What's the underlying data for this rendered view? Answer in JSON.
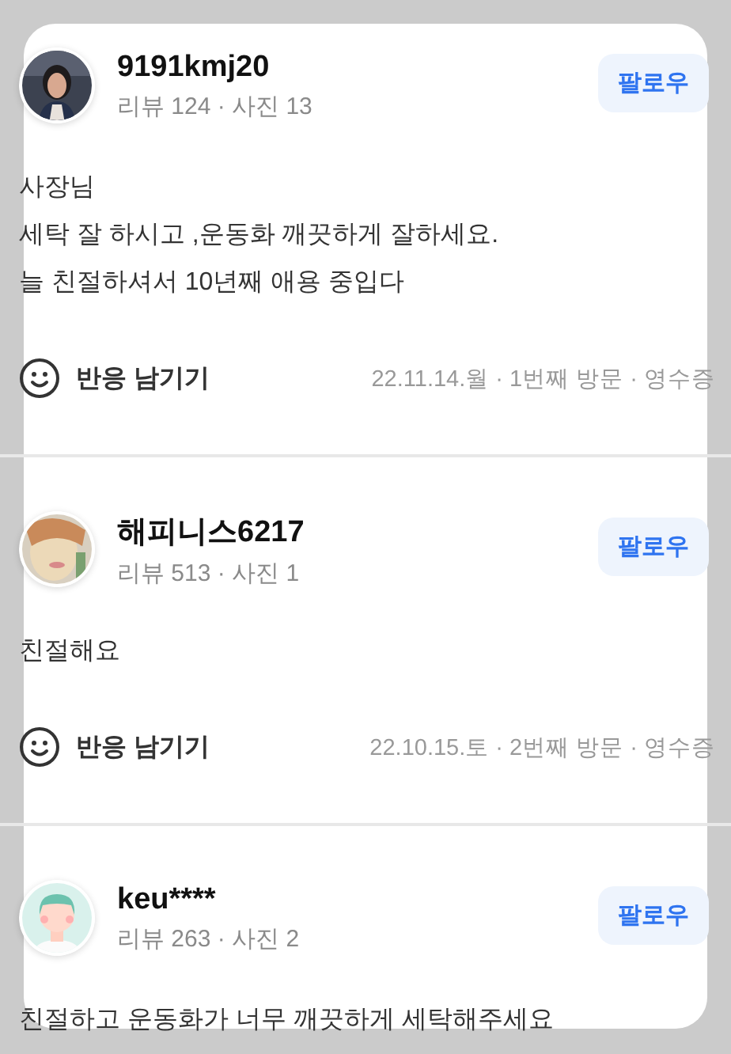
{
  "reviews": [
    {
      "name": "9191kmj20",
      "meta": "리뷰 124 · 사진 13",
      "follow": "팔로우",
      "text": [
        "사장님",
        "세탁 잘 하시고 ,운동화 깨끗하게 잘하세요.",
        "늘 친절하셔서 10년째 애용 중입다"
      ],
      "reaction": "반응 남기기",
      "visit": "22.11.14.월 · 1번째 방문 · 영수증"
    },
    {
      "avatar": {
        "kind": "drawing"
      },
      "name": "해피니스6217",
      "meta": "리뷰 513 · 사진 1",
      "follow": "팔로우",
      "text": [
        "친절해요"
      ],
      "reaction": "반응 남기기",
      "visit": "22.10.15.토 · 2번째 방문 · 영수증"
    },
    {
      "avatar": {
        "kind": "default"
      },
      "name": "keu****",
      "meta": "리뷰 263 · 사진 2",
      "follow": "팔로우",
      "text": [
        "친절하고 운동화가 너무 깨끗하게 세탁해주세요"
      ]
    }
  ]
}
